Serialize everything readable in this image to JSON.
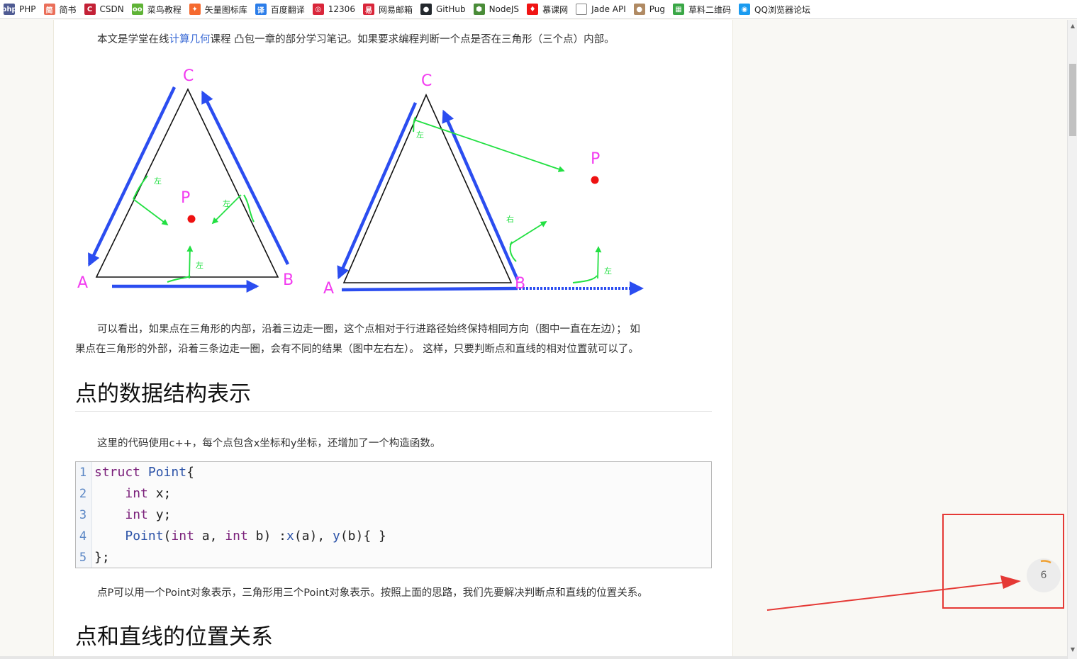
{
  "bookmarks": [
    {
      "label": "PHP",
      "icon": "php-icon",
      "color": "#4f5b93",
      "glyph": "php"
    },
    {
      "label": "简书",
      "icon": "jianshu-icon",
      "color": "#ea6f5a",
      "glyph": "简"
    },
    {
      "label": "CSDN",
      "icon": "csdn-icon",
      "color": "#c32136",
      "glyph": "C"
    },
    {
      "label": "菜鸟教程",
      "icon": "runoob-icon",
      "color": "#5fb336",
      "glyph": "oo"
    },
    {
      "label": "矢量图标库",
      "icon": "iconfont-icon",
      "color": "#f56a2f",
      "glyph": "✦"
    },
    {
      "label": "百度翻译",
      "icon": "baidu-translate-icon",
      "color": "#2b7de9",
      "glyph": "译"
    },
    {
      "label": "12306",
      "icon": "railway-12306-icon",
      "color": "#d9263a",
      "glyph": "◎"
    },
    {
      "label": "网易邮箱",
      "icon": "netease-mail-icon",
      "color": "#d9263a",
      "glyph": "易"
    },
    {
      "label": "GitHub",
      "icon": "github-icon",
      "color": "#24292e",
      "glyph": "●"
    },
    {
      "label": "NodeJS",
      "icon": "nodejs-icon",
      "color": "#4a8c38",
      "glyph": "⬢"
    },
    {
      "label": "慕课网",
      "icon": "imooc-icon",
      "color": "#f01414",
      "glyph": "♦"
    },
    {
      "label": "Jade API",
      "icon": "document-icon",
      "color": "#ffffff",
      "glyph": ""
    },
    {
      "label": "Pug",
      "icon": "pug-icon",
      "color": "#b08a63",
      "glyph": "●"
    },
    {
      "label": "草料二维码",
      "icon": "qrcode-icon",
      "color": "#3aa746",
      "glyph": "▦"
    },
    {
      "label": "QQ浏览器论坛",
      "icon": "qq-browser-icon",
      "color": "#1a9bf0",
      "glyph": "◉"
    }
  ],
  "article": {
    "intro_before_link": "本文是学堂在线",
    "intro_link": "计算几何",
    "intro_after_link": "课程 凸包一章的部分学习笔记。如果要求编程判断一个点是否在三角形（三个点）内部。",
    "figure": {
      "labels": {
        "a": "A",
        "b": "B",
        "c": "C",
        "p": "P"
      },
      "left_mark": "左",
      "right_mark": "右"
    },
    "para2_line1": "可以看出，如果点在三角形的内部，沿着三边走一圈，这个点相对于行进路径始终保持相同方向（图中一直在左边）； 如",
    "para2_line2": "果点在三角形的外部，沿着三条边走一圈，会有不同的结果（图中左右左）。 这样，只要判断点和直线的相对位置就可以了。",
    "heading1": "点的数据结构表示",
    "para3": "这里的代码使用c++，每个点包含x坐标和y坐标，还增加了一个构造函数。",
    "code_lines": [
      "1",
      "2",
      "3",
      "4",
      "5"
    ],
    "para4": "点P可以用一个Point对象表示，三角形用三个Point对象表示。按照上面的思路，我们先要解决判断点和直线的位置关系。",
    "heading2": "点和直线的位置关系"
  },
  "widget": {
    "count": "6"
  },
  "colors": {
    "link": "#3b6bd6",
    "annotation": "#e53935",
    "figure_arrow": "#2b4df0",
    "figure_mark": "#22e042",
    "figure_label": "#f23cf0",
    "point": "#ee1111"
  }
}
